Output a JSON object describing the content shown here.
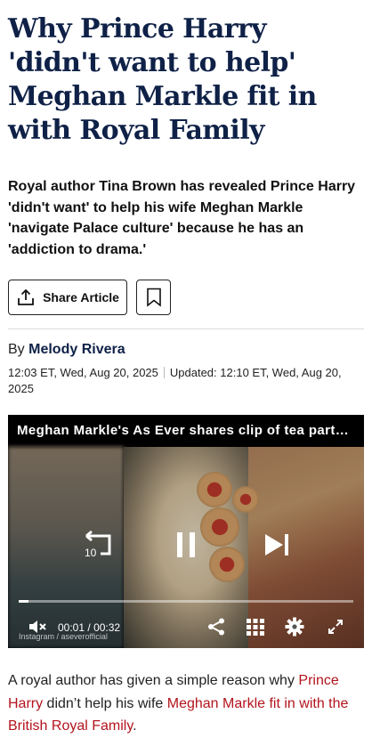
{
  "article": {
    "headline": "Why Prince Harry 'didn't want to help' Meghan Markle fit in with Royal Family",
    "standfirst": "Royal author Tina Brown has revealed Prince Harry 'didn't want' to help his wife Meghan Markle 'navigate Palace culture' because he has an 'addiction to drama.'",
    "share_label": "Share Article",
    "byline_prefix": "By",
    "author": "Melody Rivera",
    "published": "12:03 ET, Wed, Aug 20, 2025",
    "updated": "Updated: 12:10 ET, Wed, Aug 20, 2025"
  },
  "video": {
    "title": "Meghan Markle's As Ever shares clip of tea party with guests",
    "skip_back_seconds": "10",
    "current_time": "00:01",
    "duration": "00:32",
    "time_separator": "/",
    "watermark": "Instagram / aseverofficial",
    "progress_percent": 3,
    "icons": [
      "replay-10-icon",
      "pause-icon",
      "skip-next-icon",
      "mute-icon",
      "share-icon",
      "grid-icon",
      "settings-icon",
      "fullscreen-icon"
    ]
  },
  "body": {
    "intro_before": "A royal author has given a simple reason why ",
    "link1": "Prince Harry",
    "intro_middle": " didn’t help his wife ",
    "link2": "Meghan Markle fit in with the British Royal Family",
    "intro_after": "."
  },
  "colors": {
    "headline": "#0f2147",
    "link": "#b3141c",
    "author": "#0f2147"
  }
}
